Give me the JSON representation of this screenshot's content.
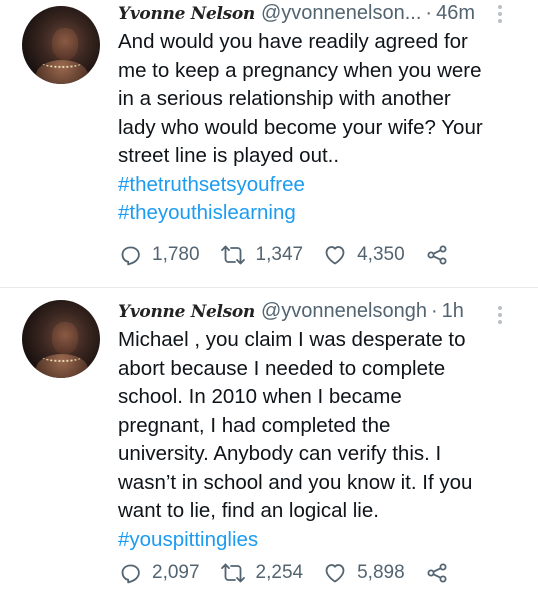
{
  "tweets": [
    {
      "author_name": "Yvonne Nelson",
      "handle": "@yvonnenelson...",
      "dot": "·",
      "time": "46m",
      "lines": [
        "And would you have readily agreed for",
        "me to keep a pregnancy when you were",
        "in a serious relationship with another",
        "lady who would become your wife? Your",
        "street line is played out.."
      ],
      "hashtags": [
        "#thetruthsetsyoufree",
        "#theyouthislearning"
      ],
      "replies": "1,780",
      "retweets": "1,347",
      "likes": "4,350"
    },
    {
      "author_name": "Yvonne Nelson",
      "handle": "@yvonnenelsongh",
      "dot": "·",
      "time": "1h",
      "lines": [
        "Michael , you claim I was desperate to",
        "abort because I needed to complete",
        "school. In 2010 when I became",
        "pregnant, I had completed the",
        "university. Anybody can verify this. I",
        "wasn’t in school and you know it. If you",
        "want to lie, find an logical lie."
      ],
      "hashtags": [
        "#youspittinglies"
      ],
      "replies": "2,097",
      "retweets": "2,254",
      "likes": "5,898"
    }
  ],
  "icons": {
    "reply": "reply-icon",
    "retweet": "retweet-icon",
    "like": "heart-icon",
    "share": "share-icon",
    "more": "more-icon"
  },
  "colors": {
    "hashtag": "#1d9bf0",
    "secondary_text": "#536471",
    "divider": "#e6e9ec"
  }
}
